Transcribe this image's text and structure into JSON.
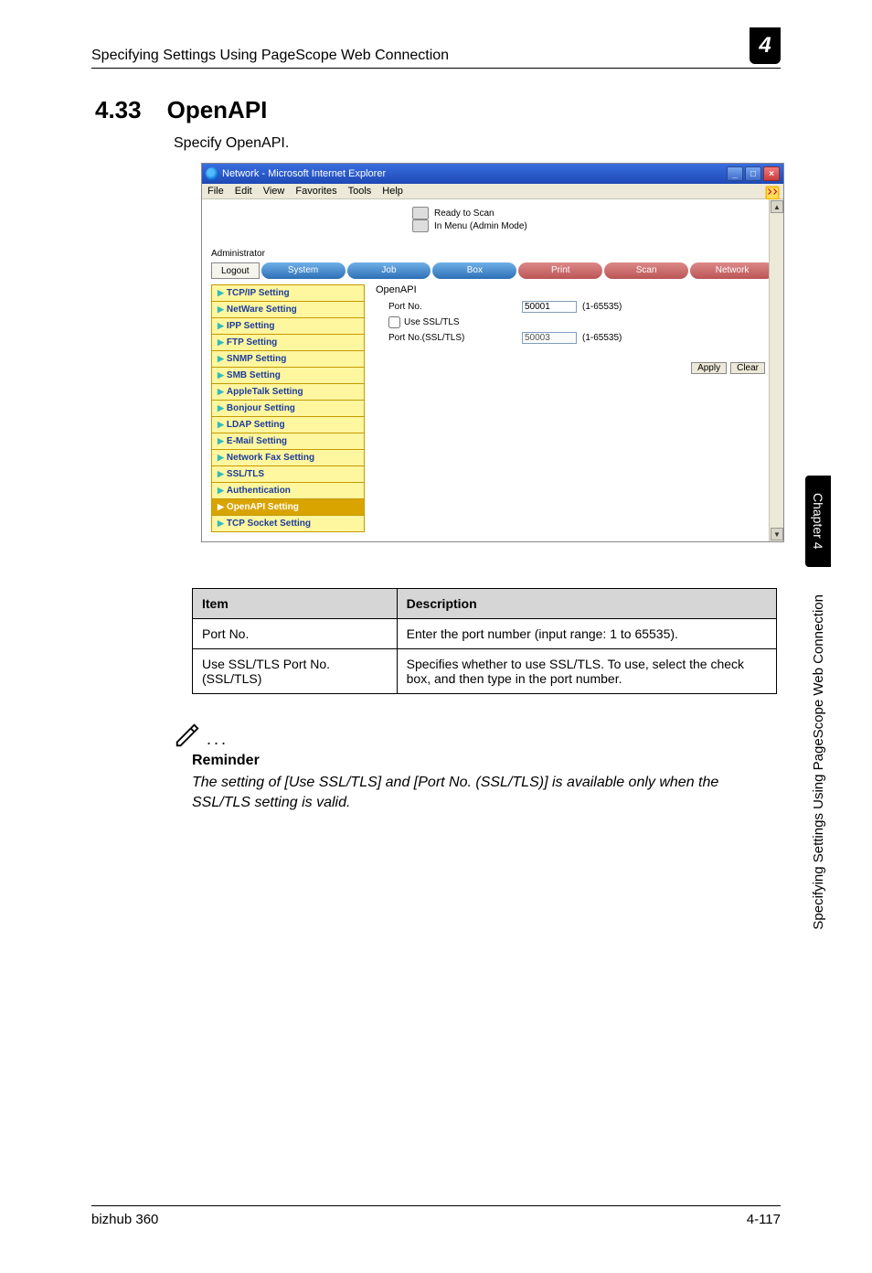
{
  "header": {
    "title": "Specifying Settings Using PageScope Web Connection",
    "chapter_badge": "4"
  },
  "section": {
    "number": "4.33",
    "title": "OpenAPI",
    "intro": "Specify OpenAPI."
  },
  "screenshot": {
    "window_title": "Network - Microsoft Internet Explorer",
    "menus": [
      "File",
      "Edit",
      "View",
      "Favorites",
      "Tools",
      "Help"
    ],
    "status_lines": [
      "Ready to Scan",
      "In Menu (Admin Mode)"
    ],
    "admin_label": "Administrator",
    "logout_label": "Logout",
    "tabs": [
      "System",
      "Job",
      "Box",
      "Print",
      "Scan",
      "Network"
    ],
    "sidebar_items": [
      "TCP/IP Setting",
      "NetWare Setting",
      "IPP Setting",
      "FTP Setting",
      "SNMP Setting",
      "SMB Setting",
      "AppleTalk Setting",
      "Bonjour Setting",
      "LDAP Setting",
      "E-Mail Setting",
      "Network Fax Setting",
      "SSL/TLS",
      "Authentication",
      "OpenAPI Setting",
      "TCP Socket Setting"
    ],
    "panel": {
      "title": "OpenAPI",
      "port_label": "Port No.",
      "port_value": "50001",
      "port_range": "(1-65535)",
      "use_ssl_label": "Use SSL/TLS",
      "port_ssl_label": "Port No.(SSL/TLS)",
      "port_ssl_value": "50003",
      "port_ssl_range": "(1-65535)",
      "apply": "Apply",
      "clear": "Clear"
    }
  },
  "table": {
    "head_item": "Item",
    "head_desc": "Description",
    "rows": [
      {
        "item": "Port No.",
        "desc": "Enter the port number (input range: 1 to 65535)."
      },
      {
        "item": "Use SSL/TLS Port No. (SSL/TLS)",
        "desc": "Specifies whether to use SSL/TLS. To use, select the check box, and then type in the port number."
      }
    ]
  },
  "note": {
    "heading": "Reminder",
    "body": "The setting of [Use SSL/TLS] and [Port No. (SSL/TLS)] is available only when the SSL/TLS setting is valid."
  },
  "side": {
    "tab": "Chapter 4",
    "text": "Specifying Settings Using PageScope Web Connection"
  },
  "footer": {
    "left": "bizhub 360",
    "right": "4-117"
  }
}
